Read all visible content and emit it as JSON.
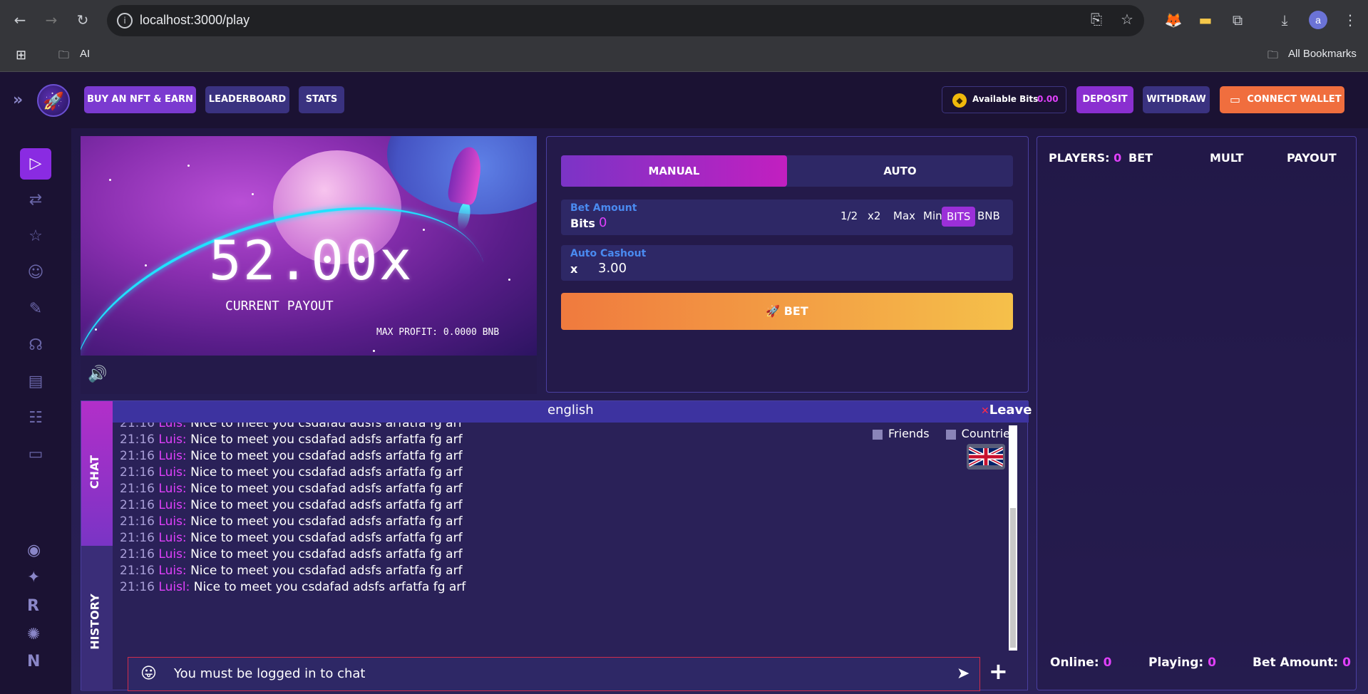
{
  "browser": {
    "url": "localhost:3000/play",
    "bookmark_folder": "AI",
    "all_bookmarks": "All Bookmarks",
    "profile_initial": "a"
  },
  "nav": {
    "buy_nft": "BUY AN NFT & EARN",
    "leaderboard": "LEADERBOARD",
    "stats": "STATS",
    "available_label": "Available Bits",
    "available_value": "0.00",
    "deposit": "DEPOSIT",
    "withdraw": "WITHDRAW",
    "connect_wallet": "CONNECT WALLET"
  },
  "game": {
    "payout": "52.00x",
    "payout_label": "CURRENT PAYOUT",
    "max_profit": "MAX PROFIT: 0.0000 BNB"
  },
  "bet": {
    "tab_manual": "MANUAL",
    "tab_auto": "AUTO",
    "amount_label": "Bet Amount",
    "amount_prefix": "Bits",
    "amount_value": "0",
    "opt_half": "1/2",
    "opt_double": "x2",
    "opt_max": "Max",
    "opt_min": "Min",
    "opt_bits": "BITS",
    "opt_bnb": "BNB",
    "cashout_label": "Auto Cashout",
    "cashout_prefix": "x",
    "cashout_value": "3.00",
    "bet_button": "BET"
  },
  "players": {
    "label": "PLAYERS:",
    "count": "0",
    "col_bet": "BET",
    "col_mult": "MULT",
    "col_payout": "PAYOUT",
    "online_label": "Online:",
    "online_value": "0",
    "playing_label": "Playing:",
    "playing_value": "0",
    "bet_amount_label": "Bet Amount:",
    "bet_amount_value": "0"
  },
  "chat": {
    "tab_chat": "CHAT",
    "tab_history": "HISTORY",
    "room": "english",
    "leave": "Leave",
    "friends": "Friends",
    "countries": "Countries",
    "input_placeholder": "You must be logged in to chat",
    "messages": [
      {
        "time": "21:16",
        "user": "Luis:",
        "text": "Nice to meet you csdafad adsfs arfatfa fg arf"
      },
      {
        "time": "21:16",
        "user": "Luis:",
        "text": "Nice to meet you csdafad adsfs arfatfa fg arf"
      },
      {
        "time": "21:16",
        "user": "Luis:",
        "text": "Nice to meet you csdafad adsfs arfatfa fg arf"
      },
      {
        "time": "21:16",
        "user": "Luis:",
        "text": "Nice to meet you csdafad adsfs arfatfa fg arf"
      },
      {
        "time": "21:16",
        "user": "Luis:",
        "text": "Nice to meet you csdafad adsfs arfatfa fg arf"
      },
      {
        "time": "21:16",
        "user": "Luis:",
        "text": "Nice to meet you csdafad adsfs arfatfa fg arf"
      },
      {
        "time": "21:16",
        "user": "Luis:",
        "text": "Nice to meet you csdafad adsfs arfatfa fg arf"
      },
      {
        "time": "21:16",
        "user": "Luis:",
        "text": "Nice to meet you csdafad adsfs arfatfa fg arf"
      },
      {
        "time": "21:16",
        "user": "Luis:",
        "text": "Nice to meet you csdafad adsfs arfatfa fg arf"
      },
      {
        "time": "21:16",
        "user": "Luis:",
        "text": "Nice to meet you csdafad adsfs arfatfa fg arf"
      },
      {
        "time": "21:16",
        "user": "Luisl:",
        "text": "Nice to meet you csdafad adsfs arfatfa fg arf"
      }
    ]
  },
  "colors": {
    "accent": "#e040fb",
    "manual_gradient_start": "#7b34c6",
    "bet_gradient_start": "#f07a3e",
    "bet_gradient_end": "#f5c04a"
  }
}
